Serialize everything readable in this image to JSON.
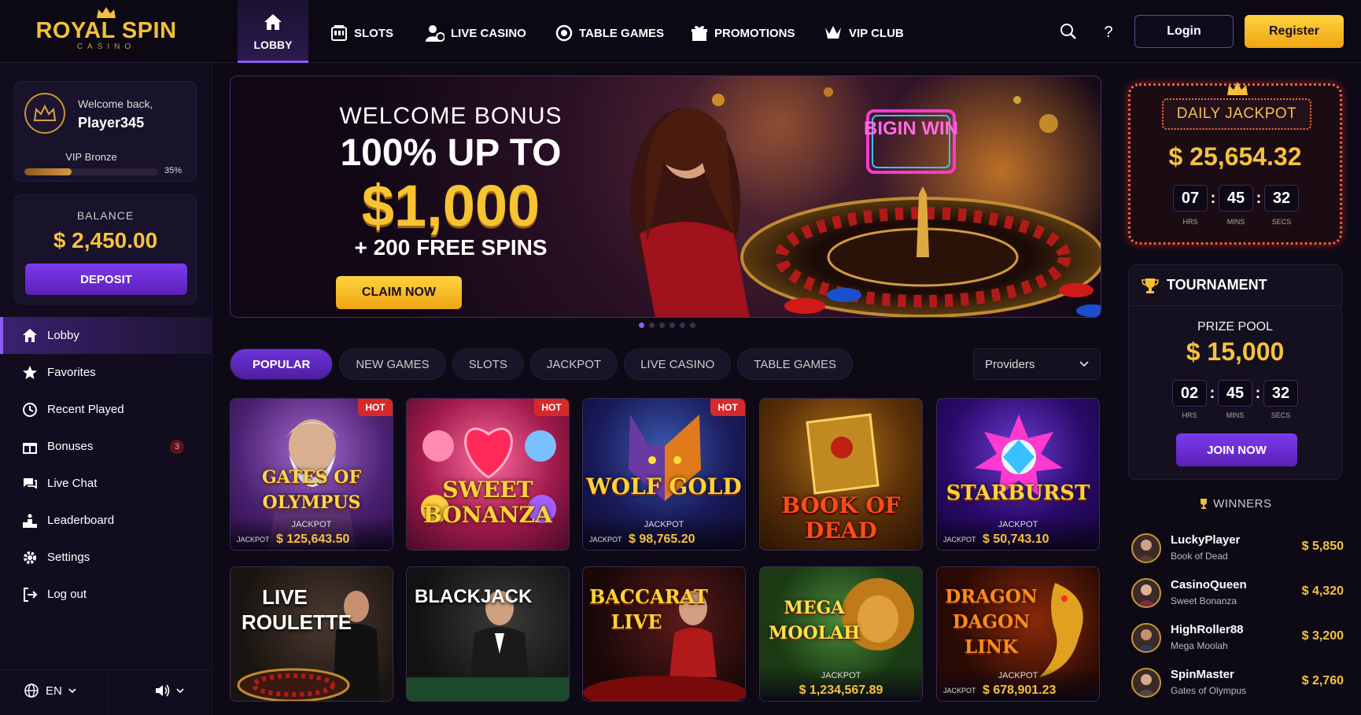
{
  "brand": {
    "name": "ROYAL SPIN",
    "sub": "CASINO"
  },
  "nav": {
    "lobby": "LOBBY",
    "items": [
      "SLOTS",
      "LIVE CASINO",
      "TABLE GAMES",
      "PROMOTIONS",
      "VIP CLUB"
    ],
    "login": "Login",
    "register": "Register"
  },
  "user": {
    "welcome": "Welcome back,",
    "name": "Player345",
    "vip_level": "VIP Bronze",
    "vip_progress_pct": "35%",
    "vip_progress": 0.35
  },
  "balance": {
    "label": "BALANCE",
    "value": "$ 2,450.00",
    "deposit": "DEPOSIT"
  },
  "sidebar": {
    "items": [
      {
        "label": "Lobby",
        "icon": "home-icon"
      },
      {
        "label": "Favorites",
        "icon": "star-icon"
      },
      {
        "label": "Recent Played",
        "icon": "clock-icon"
      },
      {
        "label": "Bonuses",
        "icon": "gift-icon",
        "badge": "3"
      },
      {
        "label": "Live Chat",
        "icon": "chat-icon"
      },
      {
        "label": "Leaderboard",
        "icon": "podium-icon"
      },
      {
        "label": "Settings",
        "icon": "gear-icon"
      },
      {
        "label": "Log out",
        "icon": "logout-icon"
      }
    ],
    "language": "EN"
  },
  "banner": {
    "subtitle": "WELCOME BONUS",
    "headline": "100% UP TO",
    "amount": "$1,000",
    "spins": "+ 200 FREE SPINS",
    "cta": "CLAIM NOW",
    "sign": "BIGIN WIN"
  },
  "tabs": [
    "POPULAR",
    "NEW GAMES",
    "SLOTS",
    "JACKPOT",
    "LIVE CASINO",
    "TABLE GAMES"
  ],
  "providers": "Providers",
  "games": [
    {
      "title": "GATES OF OLYMPUS",
      "hot": "HOT",
      "jackpot_label": "JACKPOT",
      "jackpot_prefix": "JACKPOT",
      "jackpot": "$ 125,643.50"
    },
    {
      "title": "SWEET BONANZA",
      "hot": "HOT"
    },
    {
      "title": "WOLF GOLD",
      "hot": "HOT",
      "jackpot_label": "JACKPOT",
      "jackpot_prefix": "JACKPOT",
      "jackpot": "$ 98,765.20"
    },
    {
      "title": "BOOK OF DEAD"
    },
    {
      "title": "STARBURST",
      "jackpot_label": "JACKPOT",
      "jackpot_prefix": "JACKPOT",
      "jackpot": "$ 50,743.10"
    },
    {
      "title": "LIVE ROULETTE"
    },
    {
      "title": "BLACKJACK"
    },
    {
      "title": "BACCARAT LIVE"
    },
    {
      "title": "MEGA MOOLAH",
      "jackpot_label": "JACKPOT",
      "jackpot": "$ 1,234,567.89"
    },
    {
      "title": "DRAGON DAGON LINK",
      "jackpot_label": "JACKPOT",
      "jackpot_prefix": "JACKPOT",
      "jackpot": "$ 678,901.23"
    }
  ],
  "daily_jackpot": {
    "title": "DAILY JACKPOT",
    "amount": "$ 25,654.32",
    "hrs": "07",
    "mins": "45",
    "secs": "32",
    "u_hrs": "HRS",
    "u_mins": "MINS",
    "u_secs": "SECS"
  },
  "tournament": {
    "title": "TOURNAMENT",
    "prize_label": "PRIZE POOL",
    "prize": "$ 15,000",
    "hrs": "02",
    "mins": "45",
    "secs": "32",
    "u_hrs": "HRS",
    "u_mins": "MINS",
    "u_secs": "SECS",
    "cta": "JOIN NOW"
  },
  "winners": {
    "title": "WINNERS",
    "list": [
      {
        "name": "LuckyPlayer",
        "game": "Book of Dead",
        "amount": "$ 5,850"
      },
      {
        "name": "CasinoQueen",
        "game": "Sweet Bonanza",
        "amount": "$ 4,320"
      },
      {
        "name": "HighRoller88",
        "game": "Mega Moolah",
        "amount": "$ 3,200"
      },
      {
        "name": "SpinMaster",
        "game": "Gates of Olympus",
        "amount": "$ 2,760"
      }
    ]
  },
  "colors": {
    "accent": "#7c3aed",
    "gold": "#f6c140",
    "hot": "#d62a2a",
    "background": "#0d0a16"
  }
}
